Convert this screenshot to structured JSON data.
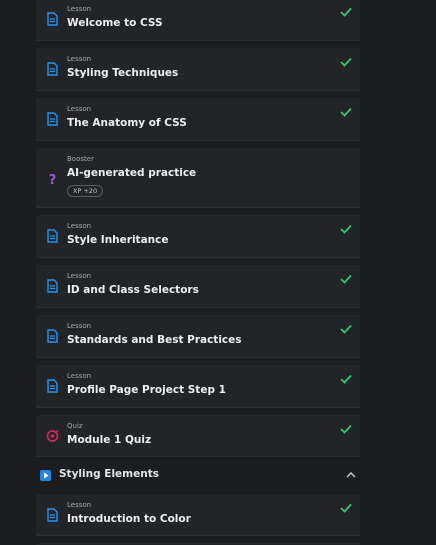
{
  "items": [
    {
      "type": "Lesson",
      "title": "Welcome to CSS",
      "icon": "lesson-icon",
      "done": true
    },
    {
      "type": "Lesson",
      "title": "Styling Techniques",
      "icon": "lesson-icon",
      "done": true
    },
    {
      "type": "Lesson",
      "title": "The Anatomy of CSS",
      "icon": "lesson-icon",
      "done": true
    },
    {
      "type": "Booster",
      "title": "AI-generated practice",
      "icon": "question-icon",
      "done": false,
      "xp": "XP +20"
    },
    {
      "type": "Lesson",
      "title": "Style Inheritance",
      "icon": "lesson-icon",
      "done": true
    },
    {
      "type": "Lesson",
      "title": "ID and Class Selectors",
      "icon": "lesson-icon",
      "done": true
    },
    {
      "type": "Lesson",
      "title": "Standards and Best Practices",
      "icon": "lesson-icon",
      "done": true
    },
    {
      "type": "Lesson",
      "title": "Profile Page Project Step 1",
      "icon": "lesson-icon",
      "done": true
    },
    {
      "type": "Quiz",
      "title": "Module 1 Quiz",
      "icon": "quiz-icon",
      "done": true
    }
  ],
  "section": {
    "title": "Styling Elements",
    "icon": "play-icon",
    "expanded": true
  },
  "section_items": [
    {
      "type": "Lesson",
      "title": "Introduction to Color",
      "icon": "lesson-icon",
      "done": true
    }
  ],
  "colors": {
    "check": "#2ecc71",
    "lesson_icon": "#2196f3",
    "booster_icon": "#9b59d0",
    "quiz_icon": "#e0245e",
    "section_icon": "#1e88e5"
  }
}
